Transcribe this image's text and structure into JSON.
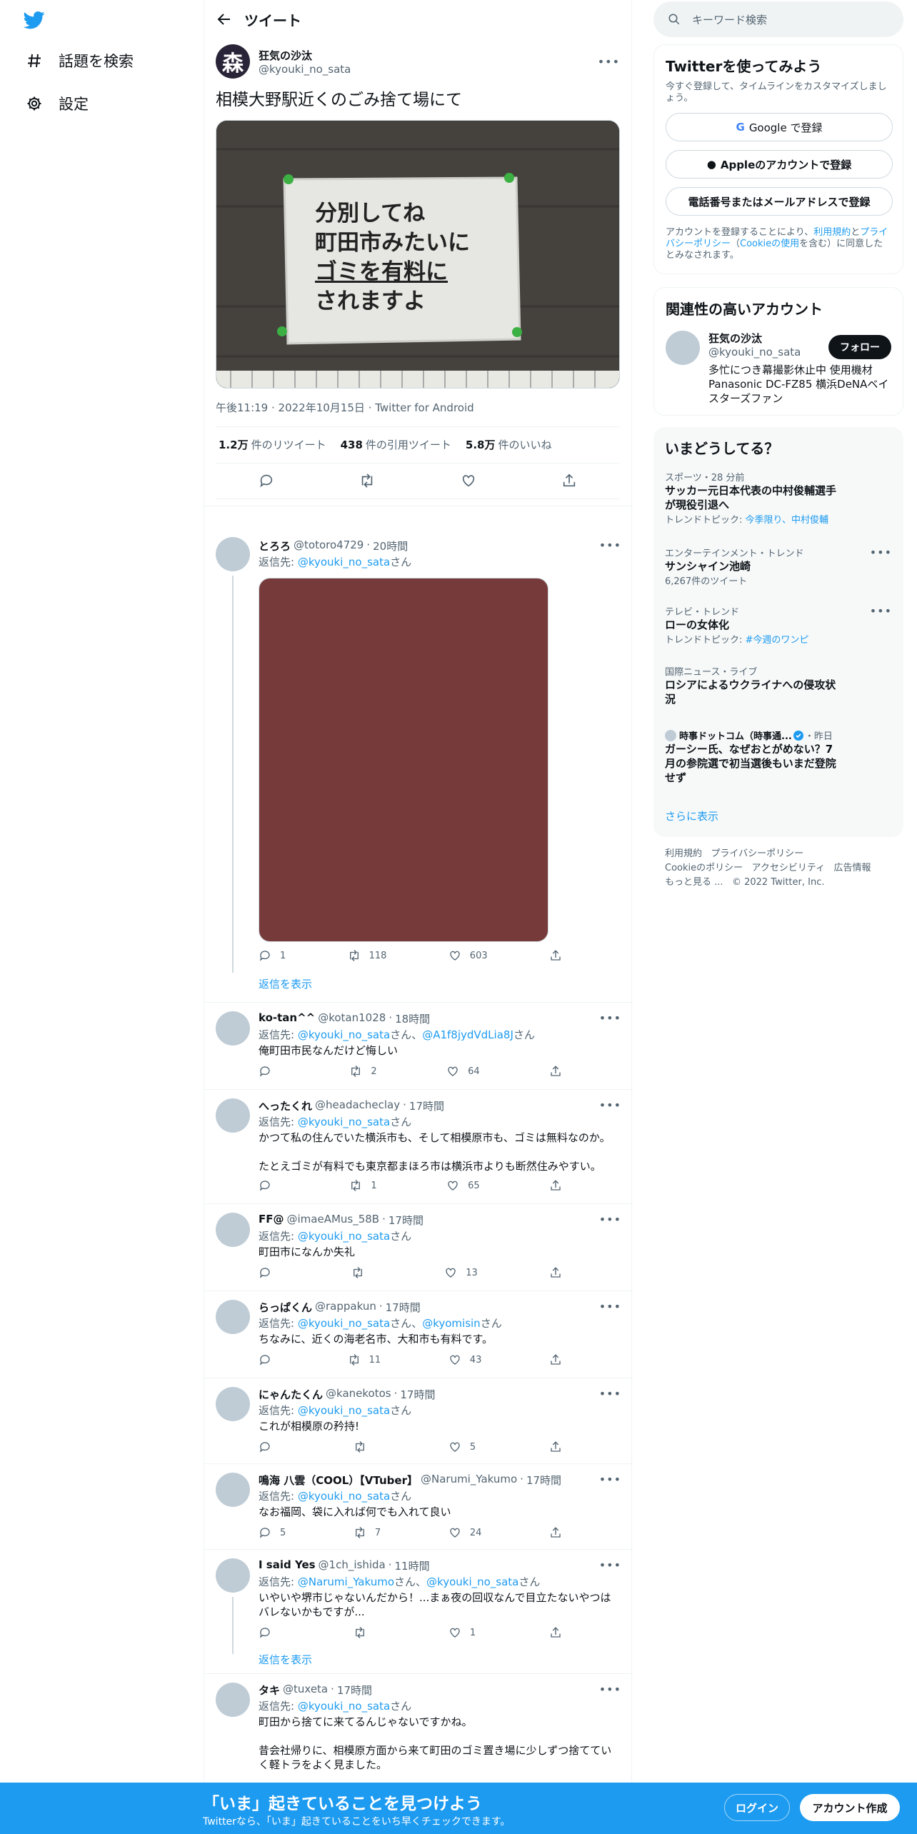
{
  "colors": {
    "accent": "#1d9bf0",
    "text": "#0f1419",
    "muted": "#536471",
    "bottom_bar": "#1d9bf0"
  },
  "nav": {
    "explore_label": "話題を検索",
    "settings_label": "設定"
  },
  "header": {
    "title": "ツイート"
  },
  "main_tweet": {
    "avatar_char": "森",
    "name": "狂気の沙汰",
    "handle": "@kyouki_no_sata",
    "text": "相模大野駅近くのごみ捨て場にて",
    "sign_lines": [
      "分別してね",
      "町田市みたいに",
      "ゴミを有料に",
      "されますよ"
    ],
    "time": "午後11:19",
    "date": "2022年10月15日",
    "client": "Twitter for Android",
    "retweets": "1.2万",
    "retweets_label": "件のリツイート",
    "quotes": "438",
    "quotes_label": "件の引用ツイート",
    "likes": "5.8万",
    "likes_label": "件のいいね"
  },
  "reply_prefix": "返信先: ",
  "san": "さん",
  "replies": [
    {
      "name": "とろろ",
      "handle": "@totoro4729",
      "time": "20時間",
      "to": [
        "@kyouki_no_sata"
      ],
      "text": "",
      "replies": "1",
      "retweets": "118",
      "likes": "603",
      "show_thread": "返信を表示"
    },
    {
      "name": "ko-tan^^",
      "handle": "@kotan1028",
      "time": "18時間",
      "to": [
        "@kyouki_no_sata",
        "@A1f8jydVdLia8J"
      ],
      "text": "俺町田市民なんだけど悔しい",
      "replies": "",
      "retweets": "2",
      "likes": "64"
    },
    {
      "name": "へったくれ",
      "handle": "@headacheclay",
      "time": "17時間",
      "to": [
        "@kyouki_no_sata"
      ],
      "text": "かつて私の住んでいた横浜市も、そして相模原市も、ゴミは無料なのか。",
      "text2": "たとえゴミが有料でも東京都まほろ市は横浜市よりも断然住みやすい。",
      "replies": "",
      "retweets": "1",
      "likes": "65"
    },
    {
      "name": "FF@",
      "handle": "@imaeAMus_58B",
      "time": "17時間",
      "to": [
        "@kyouki_no_sata"
      ],
      "text": "町田市になんか失礼",
      "replies": "",
      "retweets": "",
      "likes": "13"
    },
    {
      "name": "らっぱくん",
      "handle": "@rappakun",
      "time": "17時間",
      "to": [
        "@kyouki_no_sata",
        "@kyomisin"
      ],
      "text": "ちなみに、近くの海老名市、大和市も有料です。",
      "replies": "",
      "retweets": "11",
      "likes": "43"
    },
    {
      "name": "にゃんたくん",
      "handle": "@kanekotos",
      "time": "17時間",
      "to": [
        "@kyouki_no_sata"
      ],
      "text": "これが相模原の矜持!",
      "replies": "",
      "retweets": "",
      "likes": "5"
    },
    {
      "name": "鳴海 八雲（COOL）【VTuber】",
      "handle": "@Narumi_Yakumo",
      "time": "17時間",
      "to": [
        "@kyouki_no_sata"
      ],
      "text": "なお福岡、袋に入れば何でも入れて良い",
      "replies": "5",
      "retweets": "7",
      "likes": "24"
    },
    {
      "name": "I said Yes",
      "handle": "@1ch_ishida",
      "time": "11時間",
      "to": [
        "@Narumi_Yakumo",
        "@kyouki_no_sata"
      ],
      "text": "いやいや堺市じゃないんだから！...まぁ夜の回収なんで目立たないやつはバレないかもですが...",
      "replies": "",
      "retweets": "",
      "likes": "1",
      "show_thread": "返信を表示"
    },
    {
      "name": "タキ",
      "handle": "@tuxeta",
      "time": "17時間",
      "to": [
        "@kyouki_no_sata"
      ],
      "text": "町田から捨てに来てるんじゃないですかね。",
      "text2": "昔会社帰りに、相模原方面から来て町田のゴミ置き場に少しずつ捨てていく軽トラをよく見ました。"
    }
  ],
  "right": {
    "search_placeholder": "キーワード検索",
    "signup": {
      "title": "Twitterを使ってみよう",
      "desc": "今すぐ登録して、タイムラインをカスタマイズしましょう。",
      "google": "Google で登録",
      "apple": "Appleのアカウントで登録",
      "phone": "電話番号またはメールアドレスで登録",
      "terms_1": "アカウントを登録することにより、",
      "terms_link1": "利用規約",
      "terms_2": "と",
      "terms_link2": "プライバシーポリシー",
      "terms_3": "（",
      "terms_link3": "Cookieの使用",
      "terms_4": "を含む）に同意したとみなされます。"
    },
    "related": {
      "title": "関連性の高いアカウント",
      "name": "狂気の沙汰",
      "handle": "@kyouki_no_sata",
      "follow": "フォロー",
      "bio": "多忙につき幕撮影休止中 使用機材 Panasonic DC-FZ85 横浜DeNAベイスターズファン"
    },
    "trends": {
      "title": "いまどうしてる？",
      "items": [
        {
          "cat": "スポーツ・28 分前",
          "title": "サッカー元日本代表の中村俊輔選手が現役引退へ",
          "sub_prefix": "トレンドトピック: ",
          "sub_links": "今季限り、中村俊輔"
        },
        {
          "cat": "エンターテインメント・トレンド",
          "title": "サンシャイン池崎",
          "sub": "6,267件のツイート"
        },
        {
          "cat": "テレビ・トレンド",
          "title": "ローの女体化",
          "sub_prefix": "トレンドトピック: ",
          "sub_links": "#今週のワンピ"
        },
        {
          "cat": "国際ニュース・ライブ",
          "title": "ロシアによるウクライナへの侵攻状況"
        },
        {
          "source": "時事ドットコム（時事通...",
          "when": "・昨日",
          "title": "ガーシー氏、なぜおとがめない？7月の参院選で初当選後もいまだ登院せず"
        }
      ],
      "show_more": "さらに表示"
    },
    "footer": {
      "l1": "利用規約",
      "l2": "プライバシーポリシー",
      "l3": "Cookieのポリシー",
      "l4": "アクセシビリティ",
      "l5": "広告情報",
      "l6": "もっと見る ...",
      "copy": "© 2022 Twitter, Inc."
    }
  },
  "bottom": {
    "title": "「いま」起きていることを見つけよう",
    "sub": "Twitterなら、「いま」起きていることをいち早くチェックできます。",
    "login": "ログイン",
    "signup": "アカウント作成"
  }
}
